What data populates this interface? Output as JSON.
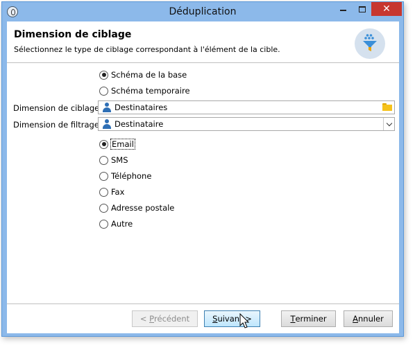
{
  "window": {
    "title": "Déduplication"
  },
  "header": {
    "title": "Dimension de ciblage",
    "subtitle": "Sélectionnez le type de ciblage correspondant à l'élément de la cible.",
    "icon": "funnel-icon"
  },
  "schema_options": [
    {
      "label": "Schéma de la base",
      "checked": true
    },
    {
      "label": "Schéma temporaire",
      "checked": false
    }
  ],
  "fields": {
    "targeting": {
      "label": "Dimension de ciblage:",
      "value": "Destinataires"
    },
    "filtering": {
      "label": "Dimension de filtrage:",
      "value": "Destinataire"
    }
  },
  "channel_options": [
    {
      "label": "Email",
      "checked": true
    },
    {
      "label": "SMS",
      "checked": false
    },
    {
      "label": "Téléphone",
      "checked": false
    },
    {
      "label": "Fax",
      "checked": false
    },
    {
      "label": "Adresse postale",
      "checked": false
    },
    {
      "label": "Autre",
      "checked": false
    }
  ],
  "buttons": {
    "previous": {
      "prefix": "< ",
      "mnemonic": "P",
      "rest": "récédent"
    },
    "next": {
      "mnemonic": "S",
      "rest": "uivant >"
    },
    "finish": {
      "mnemonic": "T",
      "rest": "erminer"
    },
    "cancel": {
      "mnemonic": "A",
      "rest": "nnuler"
    }
  },
  "colors": {
    "titlebar": "#8cb9ea",
    "close": "#c7372f",
    "user_icon": "#2e6fb5",
    "folder": "#f5c21b",
    "funnel_top": "#3b8fd8",
    "funnel_bottom": "#f0a500"
  }
}
